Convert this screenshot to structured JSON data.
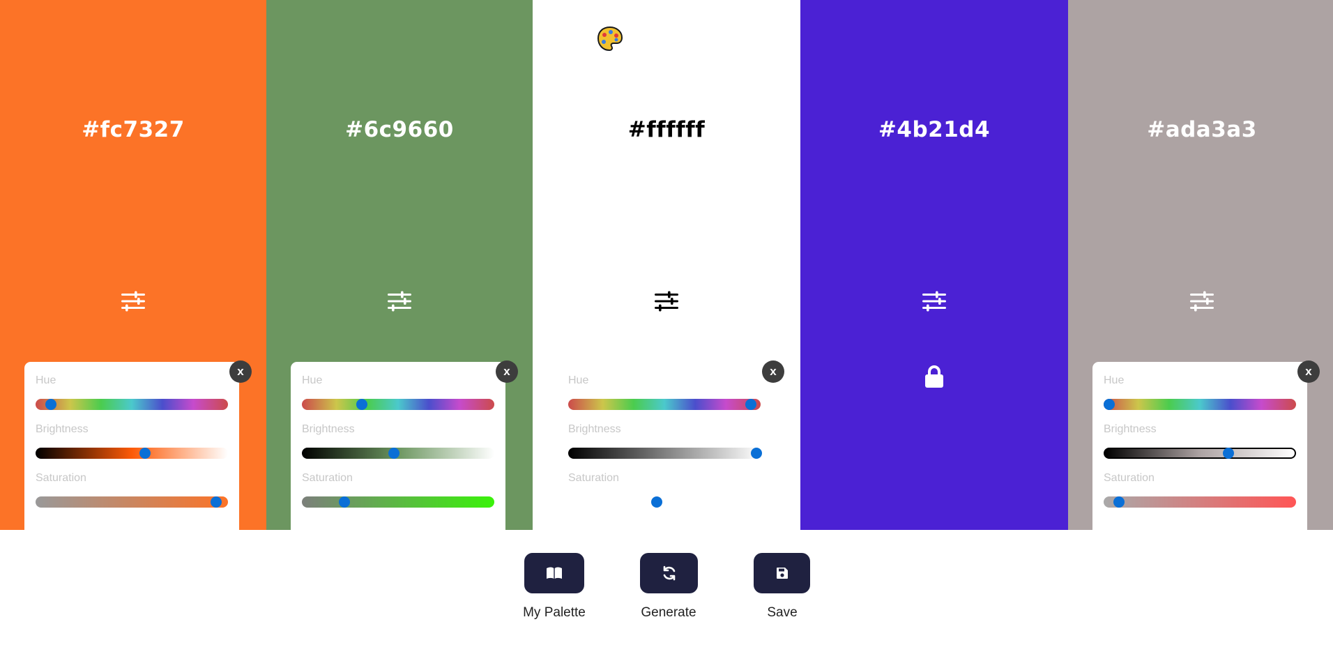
{
  "swatches": [
    {
      "hex": "#fc7327",
      "text_color": "#ffffff",
      "locked": false,
      "panel_open": true,
      "hue_label": "Hue",
      "brightness_label": "Brightness",
      "saturation_label": "Saturation",
      "close_label": "x",
      "hue_value": 0.08,
      "brightness_value": 0.57,
      "saturation_value": 0.94,
      "brightness_gradient": [
        "#000000",
        "#fc5a07",
        "#ffffff"
      ],
      "saturation_gradient": [
        "#999999",
        "#fc7327"
      ]
    },
    {
      "hex": "#6c9660",
      "text_color": "#ffffff",
      "locked": false,
      "panel_open": true,
      "hue_label": "Hue",
      "brightness_label": "Brightness",
      "saturation_label": "Saturation",
      "close_label": "x",
      "hue_value": 0.31,
      "brightness_value": 0.48,
      "saturation_value": 0.22,
      "brightness_gradient": [
        "#000000",
        "#6c9660",
        "#ffffff"
      ],
      "saturation_gradient": [
        "#7c7f7b",
        "#3af20a"
      ]
    },
    {
      "hex": "#ffffff",
      "text_color": "#000000",
      "locked": false,
      "panel_open": true,
      "panel_transparent": true,
      "hue_label": "Hue",
      "brightness_label": "Brightness",
      "saturation_label": "Saturation",
      "close_label": "x",
      "hue_value": 0.95,
      "brightness_value": 0.98,
      "saturation_value": 0.46,
      "brightness_gradient": [
        "#000000",
        "#ffffff"
      ],
      "saturation_gradient": [
        "#ffffff",
        "#ffffff"
      ]
    },
    {
      "hex": "#4b21d4",
      "text_color": "#ffffff",
      "locked": true,
      "panel_open": false
    },
    {
      "hex": "#ada3a3",
      "text_color": "#ffffff",
      "locked": false,
      "panel_open": true,
      "hue_label": "Hue",
      "brightness_label": "Brightness",
      "saturation_label": "Saturation",
      "close_label": "x",
      "hue_value": 0.03,
      "brightness_value": 0.65,
      "saturation_value": 0.08,
      "brightness_gradient": [
        "#000000",
        "#ada3a3",
        "#ffffff"
      ],
      "saturation_gradient": [
        "#a9a9a9",
        "#ff5555"
      ],
      "brightness_outlined": true
    }
  ],
  "toolbar": {
    "my_palette_label": "My Palette",
    "generate_label": "Generate",
    "save_label": "Save"
  },
  "icons": {
    "app": "palette-icon",
    "adjust": "sliders-icon",
    "lock": "lock-icon",
    "library": "book-icon",
    "generate": "refresh-icon",
    "save": "floppy-disk-icon"
  },
  "colors": {
    "button_bg": "#1f2140",
    "slider_thumb": "#0a6fd6",
    "close_bg": "#3d3d3d",
    "label_color": "#c7c7c7"
  }
}
